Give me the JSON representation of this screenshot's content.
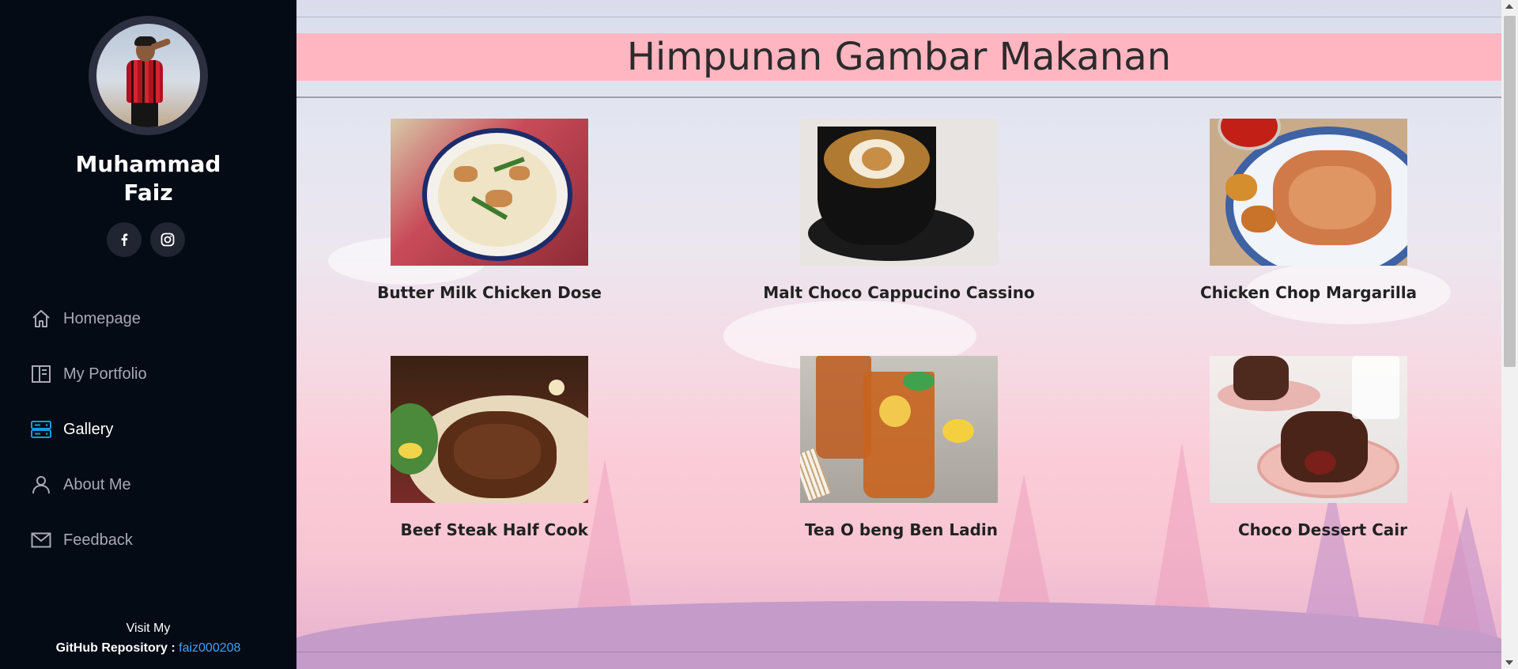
{
  "sidebar": {
    "name": "Muhammad Faiz",
    "social": {
      "facebook_icon": "facebook-icon",
      "instagram_icon": "instagram-icon"
    },
    "nav": [
      {
        "label": "Homepage",
        "icon": "home-icon",
        "active": false
      },
      {
        "label": "My Portfolio",
        "icon": "book-icon",
        "active": false
      },
      {
        "label": "Gallery",
        "icon": "server-icon",
        "active": true
      },
      {
        "label": "About Me",
        "icon": "person-icon",
        "active": false
      },
      {
        "label": "Feedback",
        "icon": "envelope-icon",
        "active": false
      }
    ],
    "footer": {
      "line1": "Visit My",
      "line2_label": "GitHub Repository : ",
      "line2_link": "faiz000208"
    }
  },
  "main": {
    "title": "Himpunan Gambar Makanan",
    "items": [
      {
        "caption": "Butter Milk Chicken Dose"
      },
      {
        "caption": "Malt Choco Cappucino Cassino"
      },
      {
        "caption": "Chicken Chop Margarilla"
      },
      {
        "caption": "Beef Steak Half Cook"
      },
      {
        "caption": "Tea O beng Ben Ladin"
      },
      {
        "caption": "Choco Dessert Cair"
      }
    ]
  },
  "colors": {
    "sidebar_bg": "#040b14",
    "active_nav": "#ffffff",
    "nav_icon_active": "#149ddd",
    "banner_bg": "#ffb6c1",
    "link": "#3ea0f5"
  }
}
